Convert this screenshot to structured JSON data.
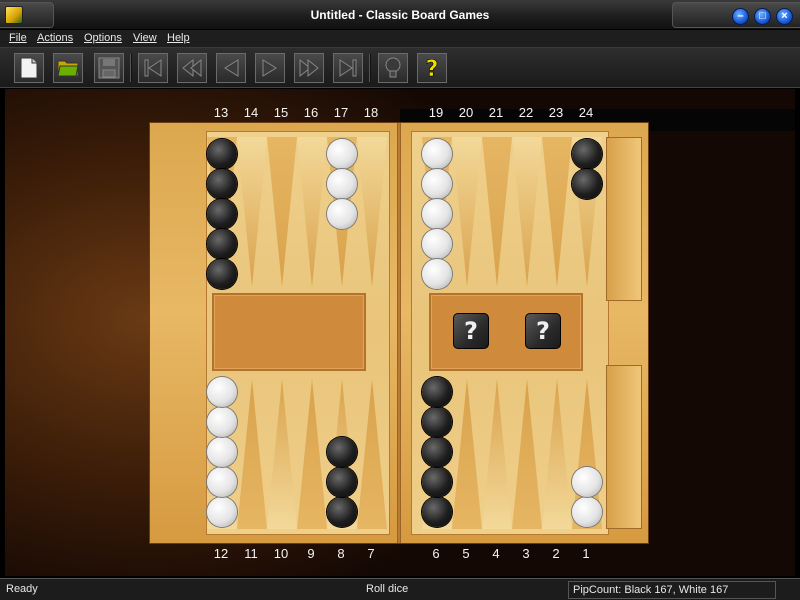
{
  "window": {
    "title": "Untitled - Classic Board Games",
    "controls": [
      "minimize",
      "maximize",
      "close"
    ]
  },
  "menu": [
    "File",
    "Actions",
    "Options",
    "View",
    "Help"
  ],
  "toolbar": [
    {
      "name": "new-game-button",
      "icon": "new-document-icon"
    },
    {
      "name": "open-button",
      "icon": "open-folder-icon"
    },
    {
      "name": "save-button",
      "icon": "save-icon"
    },
    {
      "name": "first-move-button",
      "icon": "skip-to-start-icon"
    },
    {
      "name": "previous-move-button",
      "icon": "step-back-icon"
    },
    {
      "name": "back-button",
      "icon": "play-back-icon"
    },
    {
      "name": "forward-button",
      "icon": "play-forward-icon"
    },
    {
      "name": "next-move-button",
      "icon": "fast-forward-icon"
    },
    {
      "name": "last-move-button",
      "icon": "skip-to-end-icon"
    },
    {
      "name": "hint-button",
      "icon": "lightbulb-icon"
    },
    {
      "name": "help-button",
      "icon": "question-icon"
    }
  ],
  "board": {
    "top_points": [
      "13",
      "14",
      "15",
      "16",
      "17",
      "18",
      "19",
      "20",
      "21",
      "22",
      "23",
      "24"
    ],
    "bottom_points": [
      "12",
      "11",
      "10",
      "9",
      "8",
      "7",
      "6",
      "5",
      "4",
      "3",
      "2",
      "1"
    ],
    "checkers": [
      {
        "point": 13,
        "color": "black",
        "count": 5
      },
      {
        "point": 17,
        "color": "white",
        "count": 3
      },
      {
        "point": 19,
        "color": "white",
        "count": 5
      },
      {
        "point": 24,
        "color": "black",
        "count": 2
      },
      {
        "point": 12,
        "color": "white",
        "count": 5
      },
      {
        "point": 8,
        "color": "black",
        "count": 3
      },
      {
        "point": 6,
        "color": "black",
        "count": 5
      },
      {
        "point": 1,
        "color": "white",
        "count": 2
      }
    ],
    "dice": [
      "?",
      "?"
    ],
    "colors": {
      "black_checker": "#1e1e1e",
      "white_checker": "#e4e4e4",
      "board_wood": "#dca74e"
    }
  },
  "status": {
    "left": "Ready",
    "center": "Roll dice",
    "right": "PipCount: Black 167, White 167"
  }
}
